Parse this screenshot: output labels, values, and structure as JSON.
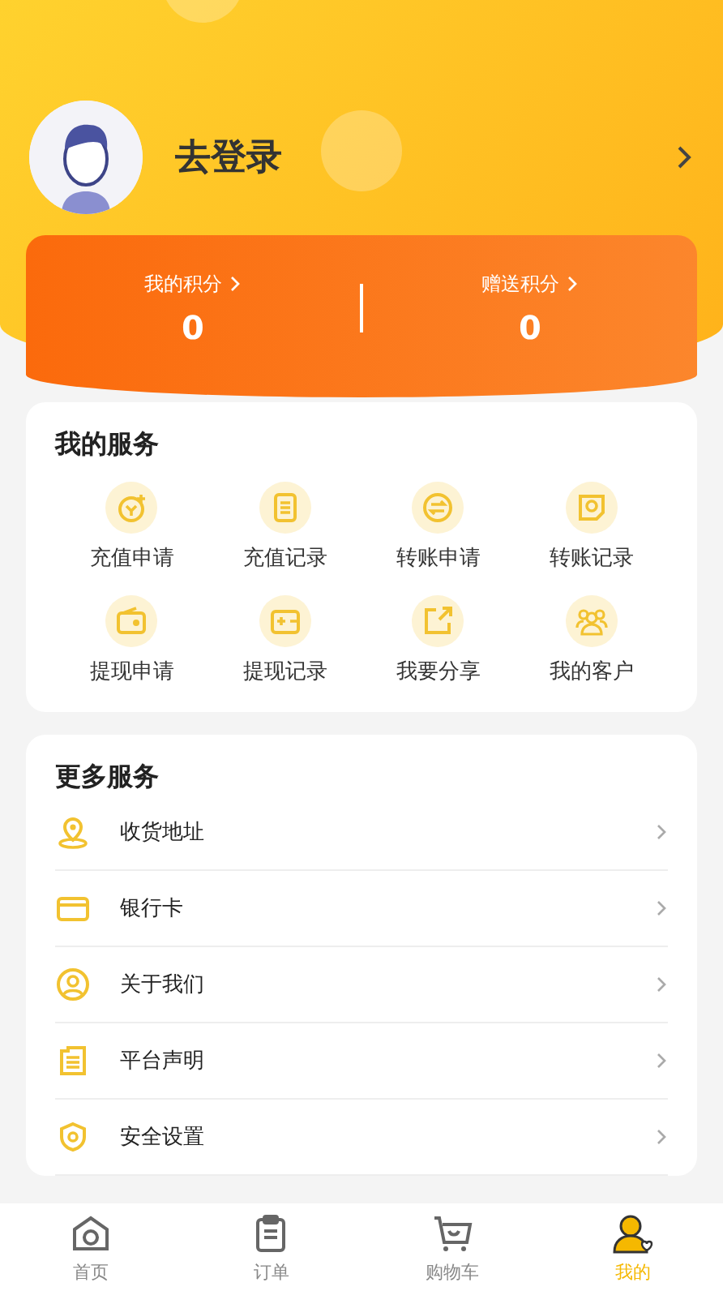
{
  "profile": {
    "name": "去登录"
  },
  "points": [
    {
      "label": "我的积分",
      "value": "0"
    },
    {
      "label": "赠送积分",
      "value": "0"
    }
  ],
  "my_services": {
    "title": "我的服务",
    "items": [
      {
        "label": "充值申请"
      },
      {
        "label": "充值记录"
      },
      {
        "label": "转账申请"
      },
      {
        "label": "转账记录"
      },
      {
        "label": "提现申请"
      },
      {
        "label": "提现记录"
      },
      {
        "label": "我要分享"
      },
      {
        "label": "我的客户"
      }
    ]
  },
  "more_services": {
    "title": "更多服务",
    "items": [
      {
        "label": "收货地址"
      },
      {
        "label": "银行卡"
      },
      {
        "label": "关于我们"
      },
      {
        "label": "平台声明"
      },
      {
        "label": "安全设置"
      }
    ]
  },
  "tab_bar": [
    {
      "label": "首页",
      "selected": false
    },
    {
      "label": "订单",
      "selected": false
    },
    {
      "label": "购物车",
      "selected": false
    },
    {
      "label": "我的",
      "selected": true
    }
  ]
}
